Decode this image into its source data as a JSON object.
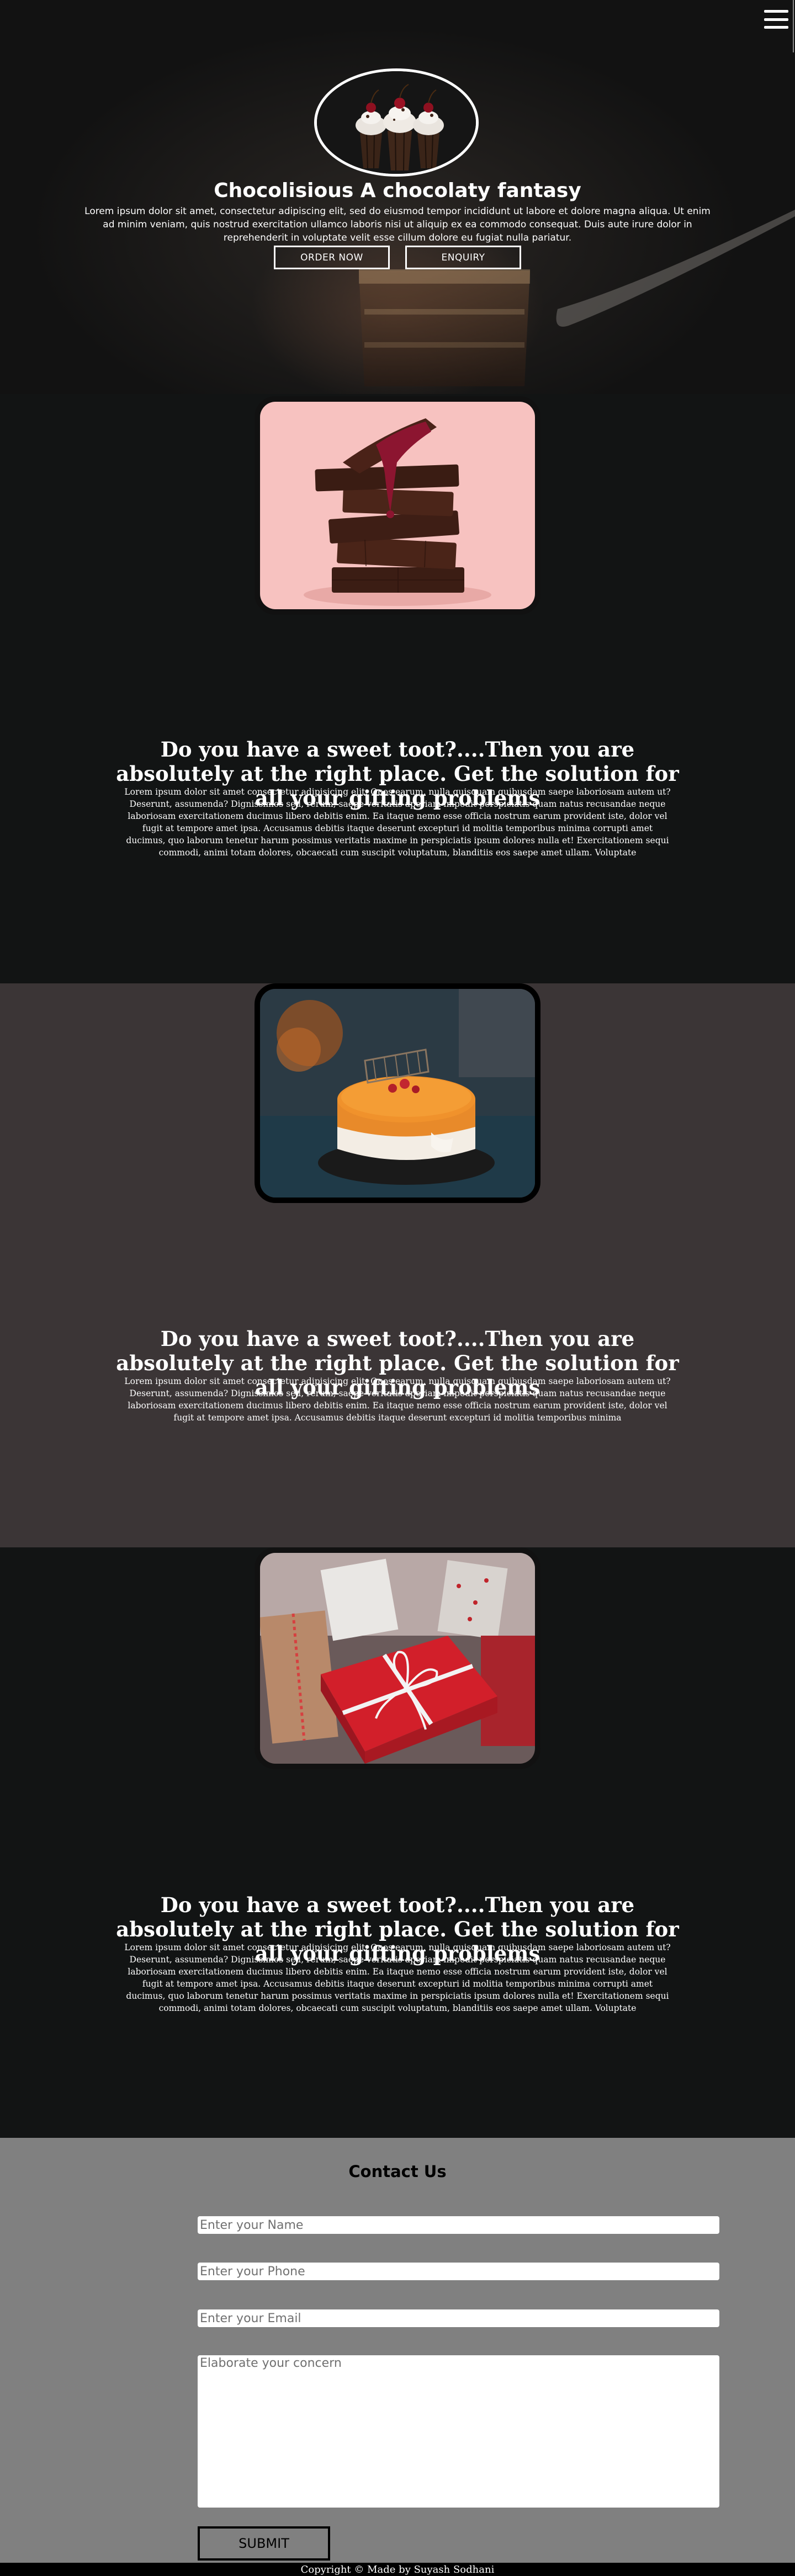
{
  "header": {
    "menu_icon": "hamburger-menu-icon"
  },
  "hero": {
    "logo_image": "chocolate-cupcakes-image",
    "title": "Chocolisious A chocolaty fantasy",
    "text": "Lorem ipsum dolor sit amet, consectetur adipiscing elit, sed do eiusmod tempor incididunt ut labore et dolore magna aliqua. Ut enim ad minim veniam, quis nostrud exercitation ullamco laboris nisi ut aliquip ex ea commodo consequat. Duis aute irure dolor in reprehenderit in voluptate velit esse cillum dolore eu fugiat nulla pariatur.",
    "order_label": "ORDER NOW",
    "enquiry_label": "ENQUIRY"
  },
  "sections": [
    {
      "image": "chocolate-stack-image",
      "title": "Do you have a sweet toot?....Then you are absolutely at the right place. Get the solution for all your gifting problems",
      "text": "Lorem ipsum dolor sit amet consectetur adipisicing elit. Quos earum, nulla quisquam quibusdam saepe laboriosam autem ut? Deserunt, assumenda? Dignissimos sed, rerum, saepe veritatis aperiam impedit perspiciatis quam natus recusandae neque laboriosam exercitationem ducimus libero debitis enim. Ea itaque nemo esse officia nostrum earum provident iste, dolor vel fugit at tempore amet ipsa. Accusamus debitis itaque deserunt excepturi id molitia temporibus minima corrupti amet ducimus, quo laborum tenetur harum possimus veritatis maxime in perspiciatis ipsum dolores nulla et! Exercitationem sequi commodi, animi totam dolores, obcaecati cum suscipit voluptatum, blanditiis eos saepe amet ullam. Voluptate"
    },
    {
      "image": "orange-cake-image",
      "title": "Do you have a sweet toot?....Then you are absolutely at the right place. Get the solution for all your gifting problems",
      "text": "Lorem ipsum dolor sit amet consectetur adipisicing elit. Quos earum, nulla quisquam quibusdam saepe laboriosam autem ut? Deserunt, assumenda? Dignissimos sed, rerum, saepe veritatis aperiam impedit perspiciatis quam natus recusandae neque laboriosam exercitationem ducimus libero debitis enim. Ea itaque nemo esse officia nostrum earum provident iste, dolor vel fugit at tempore amet ipsa. Accusamus debitis itaque deserunt excepturi id molitia temporibus minima"
    },
    {
      "image": "gift-boxes-image",
      "title": "Do you have a sweet toot?....Then you are absolutely at the right place. Get the solution for all your gifting problems",
      "text": "Lorem ipsum dolor sit amet consectetur adipisicing elit. Quos earum, nulla quisquam quibusdam saepe laboriosam autem ut? Deserunt, assumenda? Dignissimos sed, rerum, saepe veritatis aperiam impedit perspiciatis quam natus recusandae neque laboriosam exercitationem ducimus libero debitis enim. Ea itaque nemo esse officia nostrum earum provident iste, dolor vel fugit at tempore amet ipsa. Accusamus debitis itaque deserunt excepturi id molitia temporibus minima corrupti amet ducimus, quo laborum tenetur harum possimus veritatis maxime in perspiciatis ipsum dolores nulla et! Exercitationem sequi commodi, animi totam dolores, obcaecati cum suscipit voluptatum, blanditiis eos saepe amet ullam. Voluptate"
    }
  ],
  "contact": {
    "title": "Contact Us",
    "name_placeholder": "Enter your Name",
    "phone_placeholder": "Enter your Phone",
    "email_placeholder": "Enter your Email",
    "concern_placeholder": "Elaborate your concern",
    "submit_label": "SUBMIT"
  },
  "footer": {
    "text": "Copyright © Made by Suyash Sodhani"
  },
  "colors": {
    "hero_bg": "#121212",
    "section_dark": "#121414",
    "section_mid": "#3b3536",
    "contact_bg": "#808080"
  }
}
